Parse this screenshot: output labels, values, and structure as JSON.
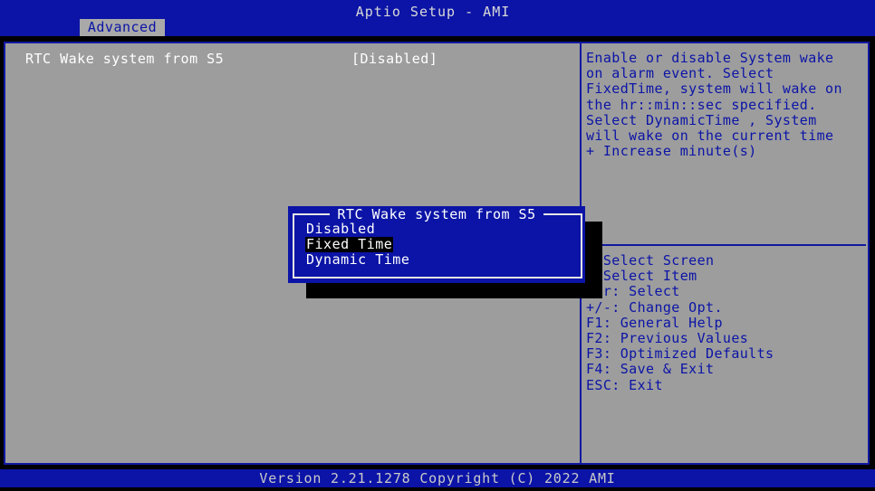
{
  "title_bar": {
    "title": "Aptio Setup - AMI",
    "active_tab": "Advanced"
  },
  "settings": [
    {
      "label": "RTC Wake system from S5",
      "value": "[Disabled]"
    }
  ],
  "help": {
    "lines": [
      "Enable or disable System wake",
      "on alarm event. Select",
      "FixedTime, system will wake on",
      "the hr::min::sec specified.",
      "Select DynamicTime , System",
      "will wake on the current time",
      "+ Increase minute(s)"
    ],
    "keys": [
      ": Select Screen",
      ": Select Item",
      "ter: Select",
      "+/-: Change Opt.",
      "F1: General Help",
      "F2: Previous Values",
      "F3: Optimized Defaults",
      "F4: Save & Exit",
      "ESC: Exit"
    ]
  },
  "popup": {
    "title": "RTC Wake system from S5",
    "options": [
      "Disabled",
      "Fixed Time",
      "Dynamic Time"
    ],
    "selected": "Fixed Time"
  },
  "footer": {
    "version": "Version 2.21.1278 Copyright (C) 2022 AMI"
  },
  "colors": {
    "bios_blue": "#0b14a6",
    "panel_gray": "#9d9d9d",
    "highlight_black": "#000000"
  }
}
